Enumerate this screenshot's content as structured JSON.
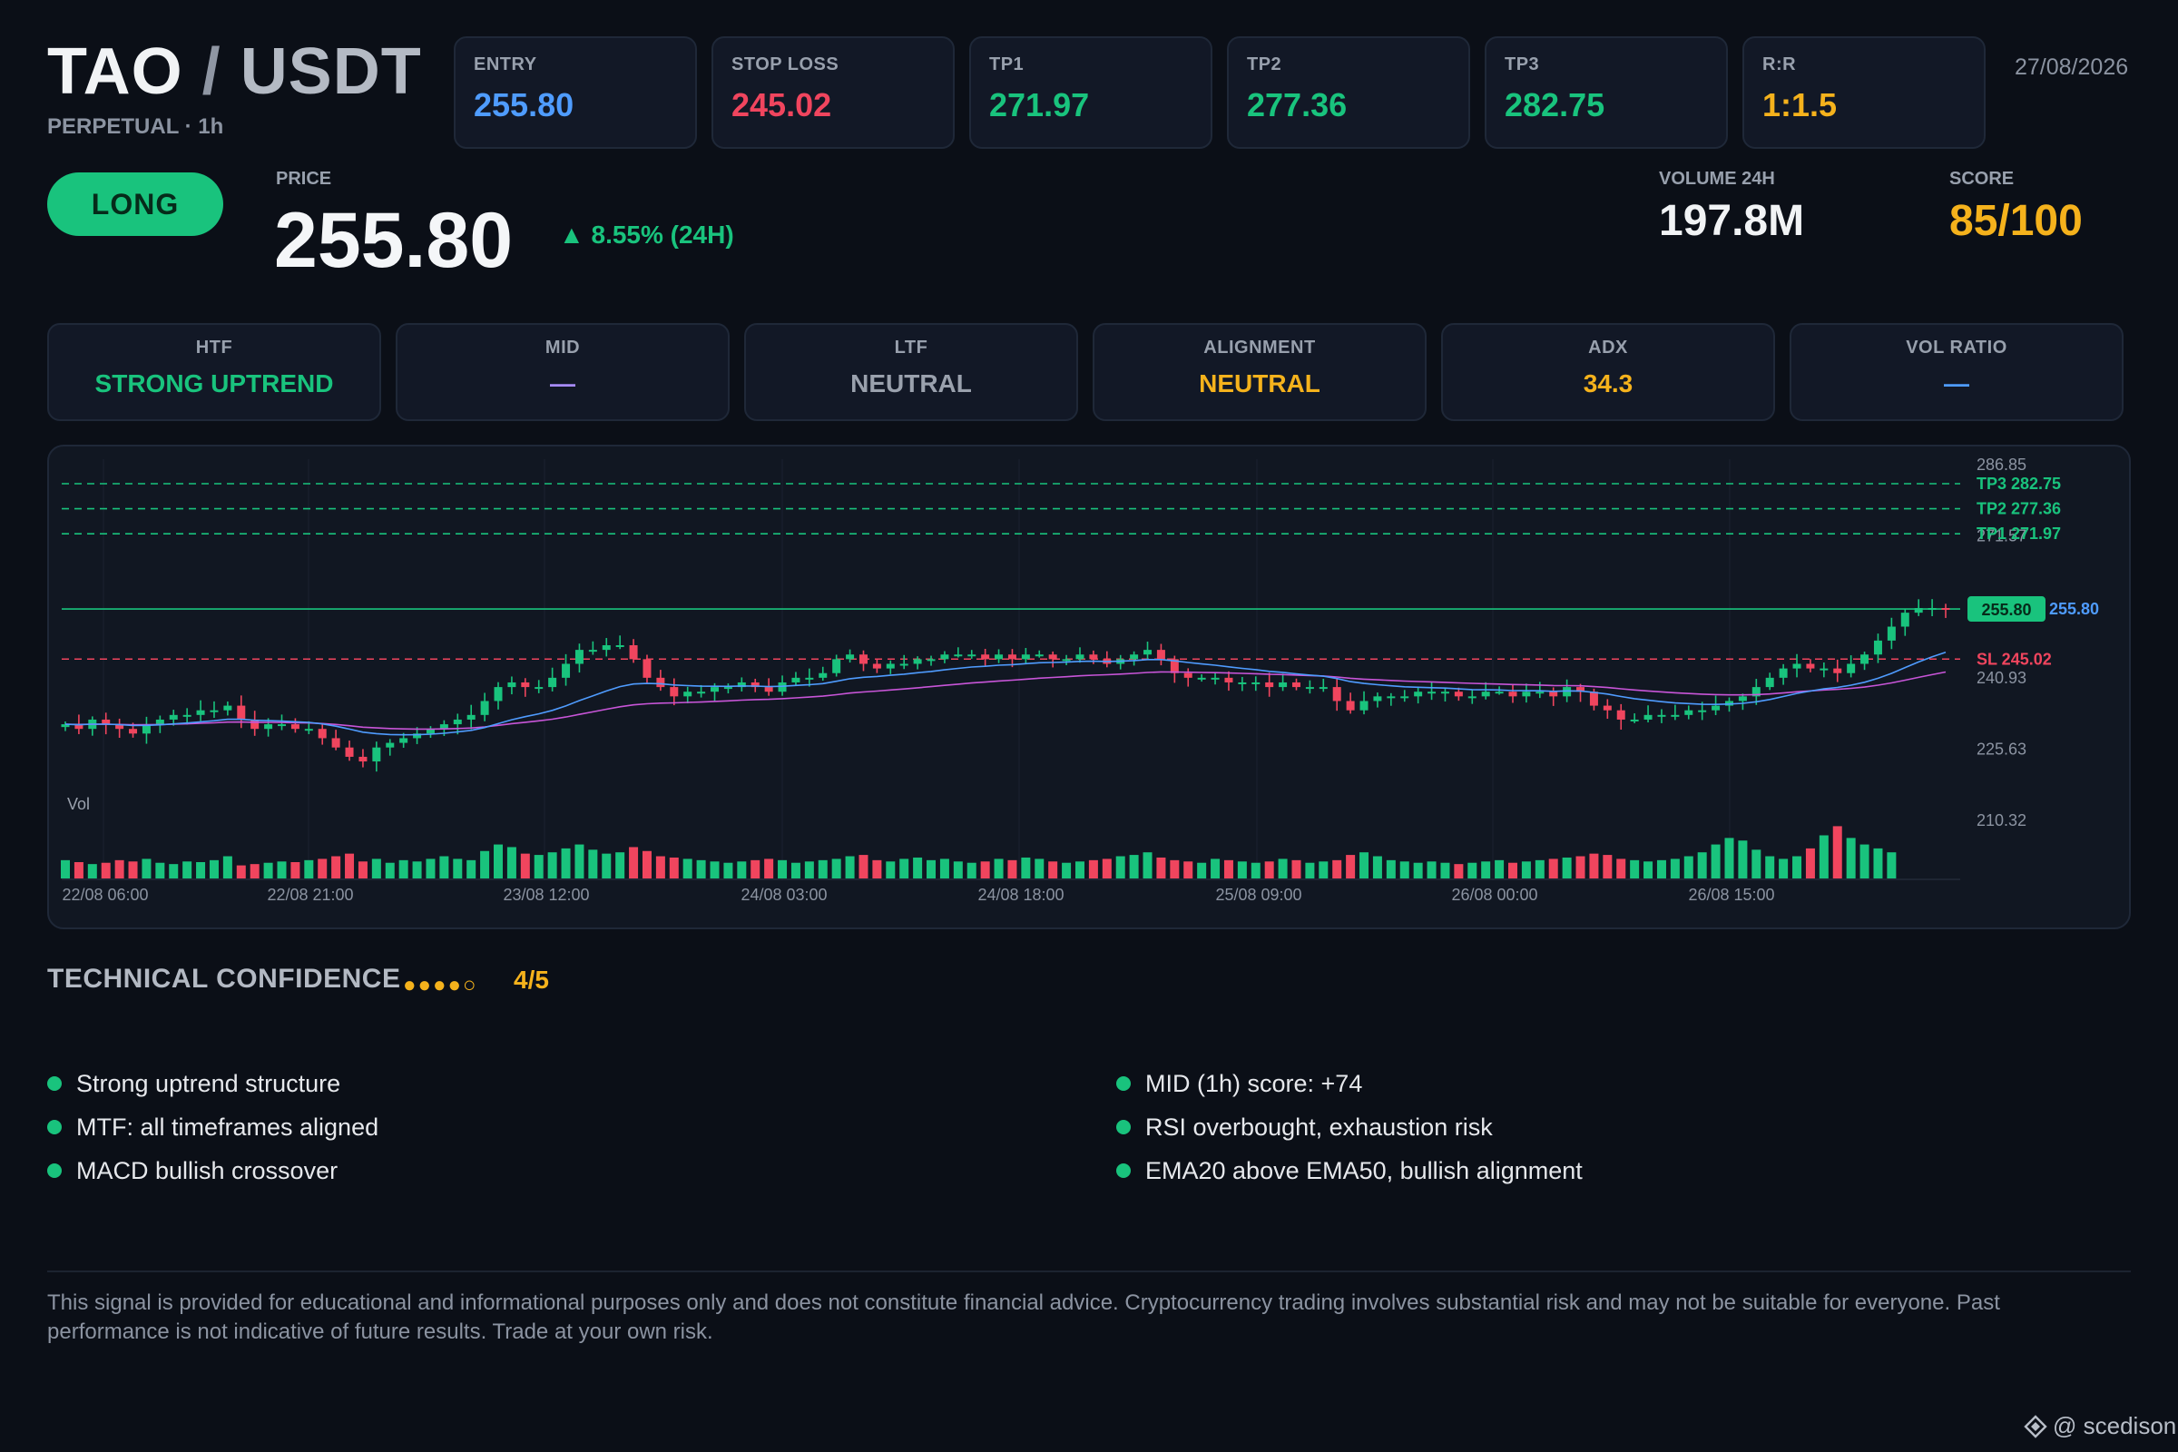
{
  "header": {
    "base": "TAO",
    "slash": "/",
    "quote": "USDT",
    "subtitle": "PERPETUAL · 1h",
    "date": "27/08/2026"
  },
  "levels": [
    {
      "label": "ENTRY",
      "value": "255.80",
      "color": "#4f9cff"
    },
    {
      "label": "STOP LOSS",
      "value": "245.02",
      "color": "#f0455e"
    },
    {
      "label": "TP1",
      "value": "271.97",
      "color": "#19c37d"
    },
    {
      "label": "TP2",
      "value": "277.36",
      "color": "#19c37d"
    },
    {
      "label": "TP3",
      "value": "282.75",
      "color": "#19c37d"
    },
    {
      "label": "R:R",
      "value": "1:1.5",
      "color": "#f5b21c"
    }
  ],
  "signal": {
    "direction": "LONG",
    "price_label": "PRICE",
    "price": "255.80",
    "change": "▲ 8.55% (24H)",
    "volume_label": "VOLUME 24H",
    "volume": "197.8M",
    "score_label": "SCORE",
    "score": "85/100"
  },
  "indicators": [
    {
      "label": "HTF",
      "value": "STRONG UPTREND",
      "color": "#19c37d"
    },
    {
      "label": "MID",
      "value": "—",
      "color": "#a78bfa"
    },
    {
      "label": "LTF",
      "value": "NEUTRAL",
      "color": "#9aa1ad"
    },
    {
      "label": "ALIGNMENT",
      "value": "NEUTRAL",
      "color": "#f5b21c"
    },
    {
      "label": "ADX",
      "value": "34.3",
      "color": "#f5b21c"
    },
    {
      "label": "VOL RATIO",
      "value": "—",
      "color": "#4f9cff"
    }
  ],
  "chart_data": {
    "type": "candlestick",
    "y_ticks": [
      "286.85",
      "271.57",
      "240.93",
      "225.63",
      "210.32"
    ],
    "x_ticks": [
      "22/08 06:00",
      "22/08 21:00",
      "23/08 12:00",
      "24/08 03:00",
      "24/08 18:00",
      "25/08 09:00",
      "26/08 00:00",
      "26/08 15:00"
    ],
    "volume_label": "Vol",
    "current_price_tag": "255.80",
    "entry_tag": "255.80",
    "lines": [
      {
        "name": "TP3 282.75",
        "value": 282.75,
        "color": "#19c37d"
      },
      {
        "name": "TP2 277.36",
        "value": 277.36,
        "color": "#19c37d"
      },
      {
        "name": "TP1 271.97",
        "value": 271.97,
        "color": "#19c37d"
      },
      {
        "name": "SL 245.02",
        "value": 245.02,
        "color": "#f0455e"
      }
    ],
    "close": [
      231,
      230,
      232,
      231,
      230,
      229,
      231,
      232,
      233,
      233,
      234,
      234,
      235,
      232,
      230,
      231,
      231,
      230,
      230,
      228,
      226,
      224,
      223,
      226,
      227,
      228,
      229,
      230,
      231,
      232,
      233,
      236,
      239,
      240,
      239,
      239,
      241,
      244,
      247,
      247,
      248,
      248,
      245,
      241,
      239,
      237,
      238,
      238,
      239,
      239,
      240,
      239,
      238,
      240,
      241,
      241,
      242,
      245,
      246,
      244,
      243,
      244,
      244,
      245,
      245,
      246,
      246,
      246,
      245,
      246,
      245,
      246,
      246,
      245,
      245,
      246,
      245,
      244,
      245,
      246,
      247,
      245,
      242,
      241,
      241,
      241,
      240,
      240,
      240,
      239,
      240,
      239,
      239,
      239,
      236,
      234,
      236,
      237,
      237,
      237,
      238,
      238,
      238,
      237,
      237,
      238,
      238,
      237,
      238,
      238,
      237,
      239,
      238,
      235,
      234,
      232,
      232,
      233,
      233,
      233,
      234,
      234,
      235,
      236,
      237,
      239,
      241,
      243,
      244,
      243,
      243,
      242,
      244,
      246,
      249,
      252,
      255,
      256,
      256,
      255.8
    ],
    "volume": [
      28,
      25,
      22,
      24,
      28,
      26,
      30,
      24,
      22,
      26,
      25,
      28,
      34,
      20,
      22,
      24,
      26,
      25,
      28,
      30,
      34,
      38,
      26,
      30,
      24,
      28,
      26,
      30,
      34,
      30,
      28,
      42,
      52,
      48,
      38,
      36,
      40,
      46,
      52,
      44,
      38,
      40,
      48,
      42,
      34,
      32,
      30,
      28,
      26,
      24,
      26,
      28,
      30,
      28,
      24,
      26,
      28,
      30,
      34,
      36,
      28,
      26,
      30,
      32,
      28,
      30,
      26,
      24,
      26,
      30,
      28,
      32,
      30,
      26,
      24,
      26,
      28,
      30,
      34,
      36,
      40,
      32,
      28,
      26,
      24,
      30,
      28,
      26,
      24,
      26,
      30,
      28,
      24,
      26,
      28,
      36,
      40,
      34,
      28,
      26,
      24,
      26,
      24,
      22,
      24,
      26,
      28,
      24,
      26,
      28,
      30,
      32,
      34,
      38,
      36,
      30,
      28,
      26,
      28,
      30,
      34,
      40,
      52,
      62,
      58,
      44,
      34,
      30,
      34,
      46,
      66,
      80,
      62,
      52,
      46,
      40
    ]
  },
  "confidence": {
    "title": "TECHNICAL CONFIDENCE",
    "dots": "●●●●○",
    "score": "4/5",
    "left": [
      "Strong uptrend structure",
      "MTF: all timeframes aligned",
      "MACD bullish crossover"
    ],
    "right": [
      "MID (1h) score: +74",
      "RSI overbought, exhaustion risk",
      "EMA20 above EMA50, bullish alignment"
    ]
  },
  "disclaimer": "This signal is provided for educational and informational purposes only and does not constitute financial advice. Cryptocurrency trading involves substantial risk and may not be suitable for everyone. Past performance is not indicative of future results. Trade at your own risk.",
  "credit": "@ scedison",
  "colors": {
    "bull": "#19c37d",
    "bear": "#f0455e",
    "ema20": "#4f9cff",
    "ema50": "#c855d8"
  }
}
